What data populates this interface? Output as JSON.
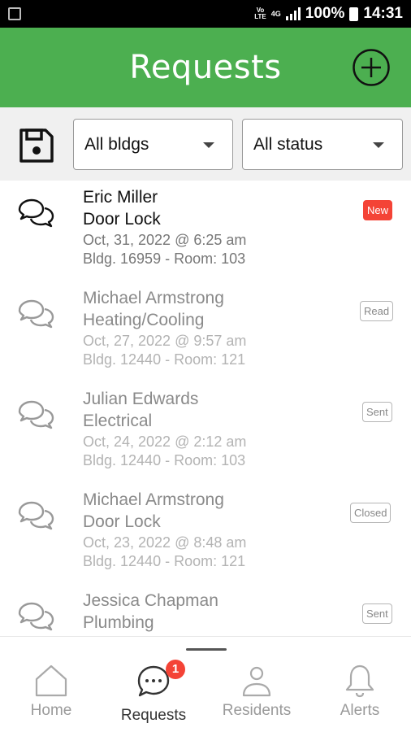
{
  "status_bar": {
    "carrier_icon": "volte-icon",
    "volte": "VoLTE",
    "network": "4G",
    "battery": "100%",
    "time": "14:31"
  },
  "header": {
    "title": "Requests",
    "add_icon": "plus-circle-icon"
  },
  "filters": {
    "save_icon": "floppy-disk-icon",
    "building": "All bldgs",
    "status": "All status"
  },
  "requests": [
    {
      "name": "Eric Miller",
      "type": "Door Lock",
      "date": "Oct, 31, 2022 @ 6:25 am",
      "location": "Bldg. 16959 - Room: 103",
      "badge": "New",
      "state": "unread"
    },
    {
      "name": "Michael Armstrong",
      "type": "Heating/Cooling",
      "date": "Oct, 27, 2022 @ 9:57 am",
      "location": "Bldg. 12440 - Room: 121",
      "badge": "Read",
      "state": "read"
    },
    {
      "name": "Julian Edwards",
      "type": "Electrical",
      "date": "Oct, 24, 2022 @ 2:12 am",
      "location": "Bldg. 12440 - Room: 103",
      "badge": "Sent",
      "state": "read"
    },
    {
      "name": "Michael Armstrong",
      "type": "Door Lock",
      "date": "Oct, 23, 2022 @ 8:48 am",
      "location": "Bldg. 12440 - Room: 121",
      "badge": "Closed",
      "state": "read"
    },
    {
      "name": "Jessica Chapman",
      "type": "Plumbing",
      "date": "",
      "location": "",
      "badge": "Sent",
      "state": "read"
    }
  ],
  "colors": {
    "accent": "#4caf50",
    "badge_new": "#f44336"
  },
  "bottom_nav": {
    "home": "Home",
    "requests": "Requests",
    "requests_count": "1",
    "residents": "Residents",
    "alerts": "Alerts"
  }
}
